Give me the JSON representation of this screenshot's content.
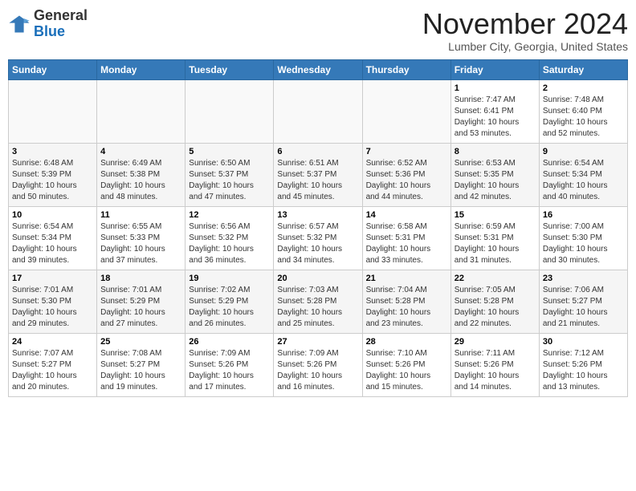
{
  "header": {
    "logo_line1": "General",
    "logo_line2": "Blue",
    "month": "November 2024",
    "location": "Lumber City, Georgia, United States"
  },
  "weekdays": [
    "Sunday",
    "Monday",
    "Tuesday",
    "Wednesday",
    "Thursday",
    "Friday",
    "Saturday"
  ],
  "weeks": [
    [
      {
        "day": "",
        "info": ""
      },
      {
        "day": "",
        "info": ""
      },
      {
        "day": "",
        "info": ""
      },
      {
        "day": "",
        "info": ""
      },
      {
        "day": "",
        "info": ""
      },
      {
        "day": "1",
        "info": "Sunrise: 7:47 AM\nSunset: 6:41 PM\nDaylight: 10 hours\nand 53 minutes."
      },
      {
        "day": "2",
        "info": "Sunrise: 7:48 AM\nSunset: 6:40 PM\nDaylight: 10 hours\nand 52 minutes."
      }
    ],
    [
      {
        "day": "3",
        "info": "Sunrise: 6:48 AM\nSunset: 5:39 PM\nDaylight: 10 hours\nand 50 minutes."
      },
      {
        "day": "4",
        "info": "Sunrise: 6:49 AM\nSunset: 5:38 PM\nDaylight: 10 hours\nand 48 minutes."
      },
      {
        "day": "5",
        "info": "Sunrise: 6:50 AM\nSunset: 5:37 PM\nDaylight: 10 hours\nand 47 minutes."
      },
      {
        "day": "6",
        "info": "Sunrise: 6:51 AM\nSunset: 5:37 PM\nDaylight: 10 hours\nand 45 minutes."
      },
      {
        "day": "7",
        "info": "Sunrise: 6:52 AM\nSunset: 5:36 PM\nDaylight: 10 hours\nand 44 minutes."
      },
      {
        "day": "8",
        "info": "Sunrise: 6:53 AM\nSunset: 5:35 PM\nDaylight: 10 hours\nand 42 minutes."
      },
      {
        "day": "9",
        "info": "Sunrise: 6:54 AM\nSunset: 5:34 PM\nDaylight: 10 hours\nand 40 minutes."
      }
    ],
    [
      {
        "day": "10",
        "info": "Sunrise: 6:54 AM\nSunset: 5:34 PM\nDaylight: 10 hours\nand 39 minutes."
      },
      {
        "day": "11",
        "info": "Sunrise: 6:55 AM\nSunset: 5:33 PM\nDaylight: 10 hours\nand 37 minutes."
      },
      {
        "day": "12",
        "info": "Sunrise: 6:56 AM\nSunset: 5:32 PM\nDaylight: 10 hours\nand 36 minutes."
      },
      {
        "day": "13",
        "info": "Sunrise: 6:57 AM\nSunset: 5:32 PM\nDaylight: 10 hours\nand 34 minutes."
      },
      {
        "day": "14",
        "info": "Sunrise: 6:58 AM\nSunset: 5:31 PM\nDaylight: 10 hours\nand 33 minutes."
      },
      {
        "day": "15",
        "info": "Sunrise: 6:59 AM\nSunset: 5:31 PM\nDaylight: 10 hours\nand 31 minutes."
      },
      {
        "day": "16",
        "info": "Sunrise: 7:00 AM\nSunset: 5:30 PM\nDaylight: 10 hours\nand 30 minutes."
      }
    ],
    [
      {
        "day": "17",
        "info": "Sunrise: 7:01 AM\nSunset: 5:30 PM\nDaylight: 10 hours\nand 29 minutes."
      },
      {
        "day": "18",
        "info": "Sunrise: 7:01 AM\nSunset: 5:29 PM\nDaylight: 10 hours\nand 27 minutes."
      },
      {
        "day": "19",
        "info": "Sunrise: 7:02 AM\nSunset: 5:29 PM\nDaylight: 10 hours\nand 26 minutes."
      },
      {
        "day": "20",
        "info": "Sunrise: 7:03 AM\nSunset: 5:28 PM\nDaylight: 10 hours\nand 25 minutes."
      },
      {
        "day": "21",
        "info": "Sunrise: 7:04 AM\nSunset: 5:28 PM\nDaylight: 10 hours\nand 23 minutes."
      },
      {
        "day": "22",
        "info": "Sunrise: 7:05 AM\nSunset: 5:28 PM\nDaylight: 10 hours\nand 22 minutes."
      },
      {
        "day": "23",
        "info": "Sunrise: 7:06 AM\nSunset: 5:27 PM\nDaylight: 10 hours\nand 21 minutes."
      }
    ],
    [
      {
        "day": "24",
        "info": "Sunrise: 7:07 AM\nSunset: 5:27 PM\nDaylight: 10 hours\nand 20 minutes."
      },
      {
        "day": "25",
        "info": "Sunrise: 7:08 AM\nSunset: 5:27 PM\nDaylight: 10 hours\nand 19 minutes."
      },
      {
        "day": "26",
        "info": "Sunrise: 7:09 AM\nSunset: 5:26 PM\nDaylight: 10 hours\nand 17 minutes."
      },
      {
        "day": "27",
        "info": "Sunrise: 7:09 AM\nSunset: 5:26 PM\nDaylight: 10 hours\nand 16 minutes."
      },
      {
        "day": "28",
        "info": "Sunrise: 7:10 AM\nSunset: 5:26 PM\nDaylight: 10 hours\nand 15 minutes."
      },
      {
        "day": "29",
        "info": "Sunrise: 7:11 AM\nSunset: 5:26 PM\nDaylight: 10 hours\nand 14 minutes."
      },
      {
        "day": "30",
        "info": "Sunrise: 7:12 AM\nSunset: 5:26 PM\nDaylight: 10 hours\nand 13 minutes."
      }
    ]
  ]
}
